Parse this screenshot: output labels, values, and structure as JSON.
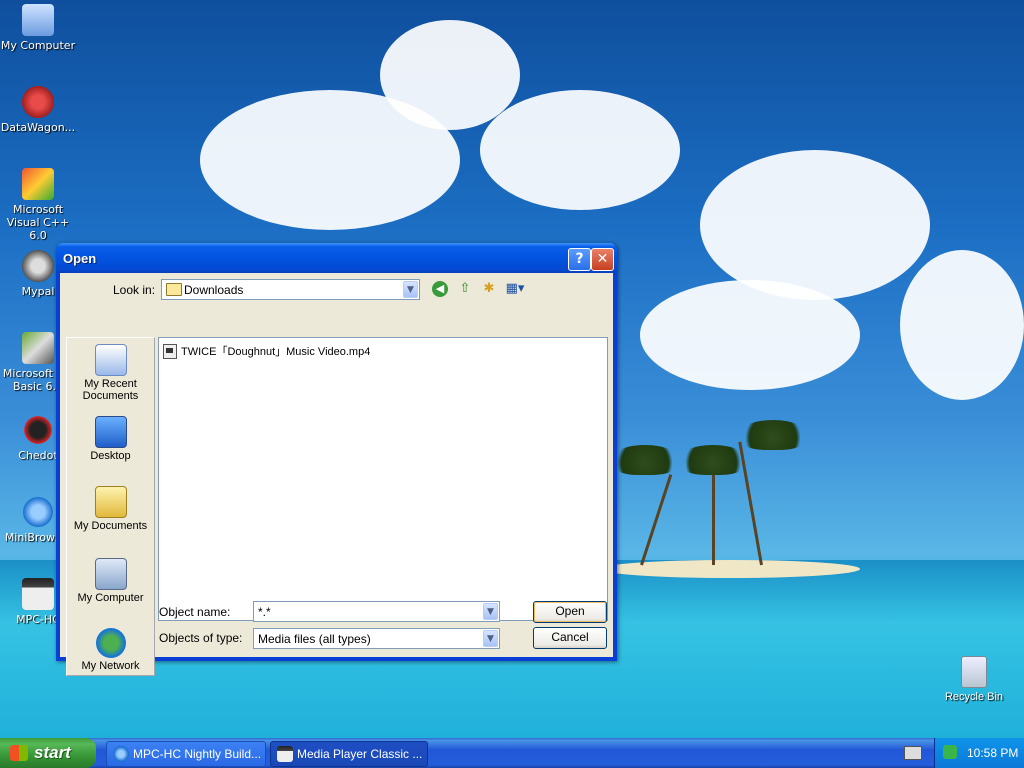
{
  "desktop": {
    "icons": [
      {
        "label": "My Computer"
      },
      {
        "label": "DataWagon..."
      },
      {
        "label": "Microsoft Visual C++ 6.0"
      },
      {
        "label": "Mypal"
      },
      {
        "label": "Microsoft V... Basic 6.0"
      },
      {
        "label": "Chedot"
      },
      {
        "label": "MiniBrows..."
      },
      {
        "label": "MPC-HC"
      }
    ],
    "recycle_bin": "Recycle Bin"
  },
  "dialog": {
    "title": "Open",
    "look_in_label": "Look in:",
    "look_in_value": "Downloads",
    "places": [
      {
        "label": "My Recent Documents"
      },
      {
        "label": "Desktop"
      },
      {
        "label": "My Documents"
      },
      {
        "label": "My Computer"
      },
      {
        "label": "My Network"
      }
    ],
    "files": [
      {
        "name": "TWICE「Doughnut」Music Video.mp4"
      }
    ],
    "object_name_label": "Object name:",
    "object_name_value": "*.*",
    "objects_of_type_label": "Objects of type:",
    "objects_of_type_value": "Media files (all types)",
    "open_button": "Open",
    "cancel_button": "Cancel"
  },
  "taskbar": {
    "start_label": "start",
    "tasks": [
      {
        "label": "MPC-HC Nightly Build..."
      },
      {
        "label": "Media Player Classic ..."
      }
    ],
    "clock": "10:58 PM"
  },
  "colors": {
    "titlebar": "#0254e0",
    "dialog_face": "#ece9d8",
    "taskbar": "#245edb",
    "start_green": "#379637"
  }
}
